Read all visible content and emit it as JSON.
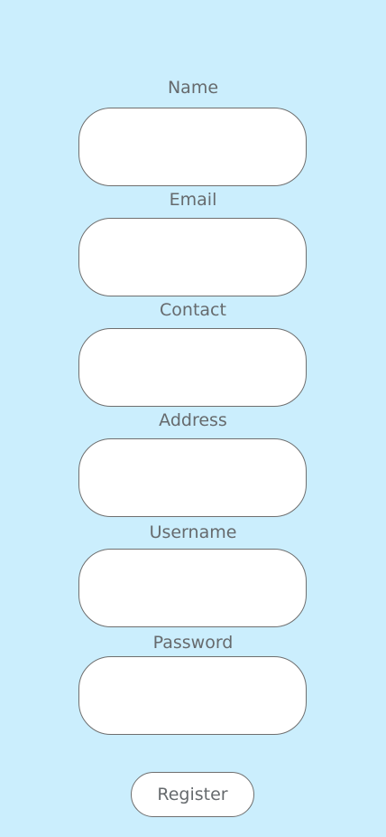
{
  "form": {
    "name_label": "Name",
    "name_value": "",
    "email_label": "Email",
    "email_value": "",
    "contact_label": "Contact",
    "contact_value": "",
    "address_label": "Address",
    "address_value": "",
    "username_label": "Username",
    "username_value": "",
    "password_label": "Password",
    "password_value": "",
    "register_label": "Register"
  },
  "colors": {
    "background": "#cbeefd",
    "field_background": "#ffffff",
    "field_border": "#6f6f6f",
    "label_text": "#666a6d"
  }
}
